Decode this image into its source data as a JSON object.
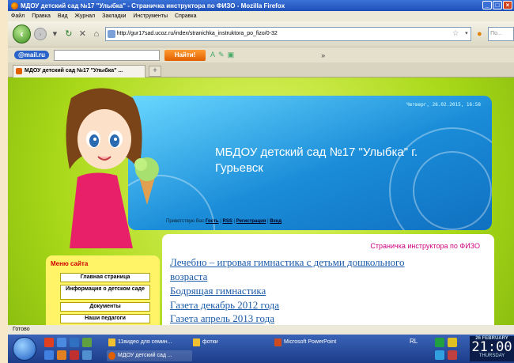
{
  "window": {
    "title": "МДОУ детский сад №17 \"Улыбка\" - Страничка инструктора по ФИЗО - Mozilla Firefox"
  },
  "menu": [
    "Файл",
    "Правка",
    "Вид",
    "Журнал",
    "Закладки",
    "Инструменты",
    "Справка"
  ],
  "nav": {
    "url": "http://gur17sad.ucoz.ru/index/stranichka_instruktora_po_fizo/0-32",
    "search_placeholder": "По..."
  },
  "toolbar": {
    "mailru_label": "@mail.ru",
    "find_label": "Найти!",
    "more_label": "»"
  },
  "tabs": [
    {
      "label": "МДОУ детский сад №17 \"Улыбка\" ..."
    }
  ],
  "page": {
    "datetime": "Четверг, 26.02.2015, 16:58",
    "site_title": "МБДОУ детский сад №17 \"Улыбка\" г. Гурьевск",
    "greeting": "Приветствую Вас",
    "guest": "Гость",
    "rss": "RSS",
    "register": "Регистрация",
    "login": "Вход",
    "sep": "|",
    "sidebar_title": "Меню сайта",
    "sidebar_items": [
      "Главная страница",
      "Информация о детском саде",
      "Документы",
      "Наши педагоги"
    ],
    "page_title": "Страничка инструктора по ФИЗО",
    "links": [
      "Лечебно – игровая гимнастика с детьми дошкольного",
      "возраста",
      "Бодрящая гимнастика",
      "Газета декабрь 2012 года",
      "Газета апрель 2013 года"
    ]
  },
  "status": "Готово",
  "taskbar": {
    "tasks": [
      "11видео для семин...",
      "фотки",
      "Microsoft PowerPoint",
      "МДОУ детский сад ..."
    ],
    "lang": "RL",
    "date": "26 FEBRUARY",
    "time": "21:00",
    "weekday": "THURSDAY"
  }
}
